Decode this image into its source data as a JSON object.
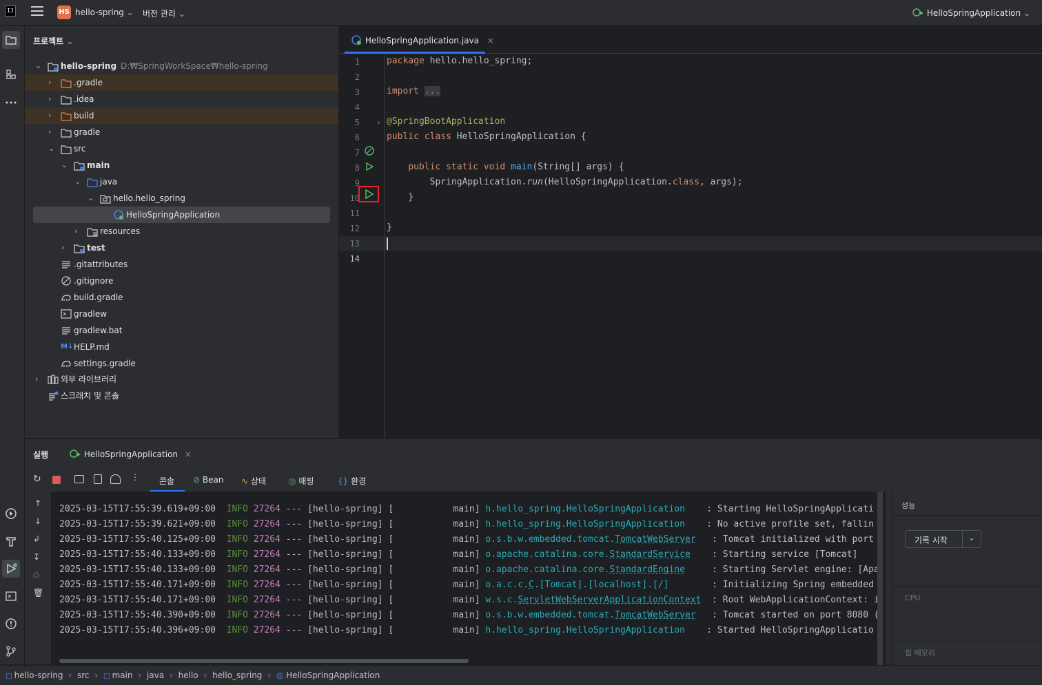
{
  "titlebar": {
    "project_badge": "HS",
    "project_name": "hello-spring",
    "vcs_label": "버전 관리",
    "run_config": "HelloSpringApplication"
  },
  "project_panel": {
    "title": "프로젝트",
    "tree": [
      {
        "label": "hello-spring",
        "path": "D:₩SpringWorkSpace₩hello-spring"
      },
      {
        "label": ".gradle"
      },
      {
        "label": ".idea"
      },
      {
        "label": "build"
      },
      {
        "label": "gradle"
      },
      {
        "label": "src"
      },
      {
        "label": "main"
      },
      {
        "label": "java"
      },
      {
        "label": "hello.hello_spring"
      },
      {
        "label": "HelloSpringApplication"
      },
      {
        "label": "resources"
      },
      {
        "label": "test"
      },
      {
        "label": ".gitattributes"
      },
      {
        "label": ".gitignore"
      },
      {
        "label": "build.gradle"
      },
      {
        "label": "gradlew"
      },
      {
        "label": "gradlew.bat"
      },
      {
        "label": "HELP.md"
      },
      {
        "label": "settings.gradle"
      },
      {
        "label": "외부 라이브러리"
      },
      {
        "label": "스크래치 및 콘솔"
      }
    ],
    "md_badge": "M↓"
  },
  "editor": {
    "tab_label": "HelloSpringApplication.java",
    "line_numbers": [
      "1",
      "2",
      "3",
      "4",
      "5",
      "6",
      "7",
      "8",
      "9",
      "10",
      "11",
      "12",
      "13",
      "14"
    ]
  },
  "run_panel": {
    "title": "실행",
    "tab_label": "HelloSpringApplication",
    "subtabs": [
      "콘솔",
      "Bean",
      "상태",
      "매핑",
      "환경"
    ],
    "log_prefix": "---",
    "log_app": "[hello-spring]",
    "log_lines": [
      {
        "ts": "2025-03-15T17:55:39.619+09:00",
        "level": "INFO",
        "pid": "27264",
        "thread": "main",
        "logger_pre": "h.hello_spring.HelloSpringApplication",
        "logger_link": "",
        "pad": "   ",
        "msg": ": Starting HelloSpringApplicati"
      },
      {
        "ts": "2025-03-15T17:55:39.621+09:00",
        "level": "INFO",
        "pid": "27264",
        "thread": "main",
        "logger_pre": "h.hello_spring.HelloSpringApplication",
        "logger_link": "",
        "pad": "   ",
        "msg": ": No active profile set, fallin"
      },
      {
        "ts": "2025-03-15T17:55:40.125+09:00",
        "level": "INFO",
        "pid": "27264",
        "thread": "main",
        "logger_pre": "o.s.b.w.embedded.tomcat.",
        "logger_link": "TomcatWebServer",
        "pad": "  ",
        "msg": ": Tomcat initialized with port"
      },
      {
        "ts": "2025-03-15T17:55:40.133+09:00",
        "level": "INFO",
        "pid": "27264",
        "thread": "main",
        "logger_pre": "o.apache.catalina.core.",
        "logger_link": "StandardService",
        "pad": "   ",
        "msg": ": Starting service [Tomcat]"
      },
      {
        "ts": "2025-03-15T17:55:40.133+09:00",
        "level": "INFO",
        "pid": "27264",
        "thread": "main",
        "logger_pre": "o.apache.catalina.core.",
        "logger_link": "StandardEngine",
        "pad": "    ",
        "msg": ": Starting Servlet engine: [Apa"
      },
      {
        "ts": "2025-03-15T17:55:40.171+09:00",
        "level": "INFO",
        "pid": "27264",
        "thread": "main",
        "logger_pre": "o.a.c.c.",
        "logger_link": "C",
        "logger_post": ".[Tomcat].[localhost].[/]",
        "pad": "       ",
        "msg": ": Initializing Spring embedded"
      },
      {
        "ts": "2025-03-15T17:55:40.171+09:00",
        "level": "INFO",
        "pid": "27264",
        "thread": "main",
        "logger_pre": "w.s.c.",
        "logger_link": "ServletWebServerApplicationContext",
        "pad": " ",
        "msg": ": Root WebApplicationContext: i"
      },
      {
        "ts": "2025-03-15T17:55:40.390+09:00",
        "level": "INFO",
        "pid": "27264",
        "thread": "main",
        "logger_pre": "o.s.b.w.embedded.tomcat.",
        "logger_link": "TomcatWebServer",
        "pad": "  ",
        "msg": ": Tomcat started on port 8080 ("
      },
      {
        "ts": "2025-03-15T17:55:40.396+09:00",
        "level": "INFO",
        "pid": "27264",
        "thread": "main",
        "logger_pre": "h.hello_spring.HelloSpringApplication",
        "logger_link": "",
        "pad": "   ",
        "msg": ": Started HelloSpringApplicatio"
      }
    ],
    "perf": {
      "title": "성능",
      "record_button": "기록 시작",
      "cpu_label": "CPU",
      "heap_label": "힙 메모리"
    }
  },
  "statusbar": {
    "breadcrumbs": [
      "hello-spring",
      "src",
      "main",
      "java",
      "hello",
      "hello_spring",
      "HelloSpringApplication"
    ]
  },
  "colors": {
    "accent": "#3574f0",
    "run_green": "#5fb865",
    "highlight_box": "#e5252c"
  }
}
